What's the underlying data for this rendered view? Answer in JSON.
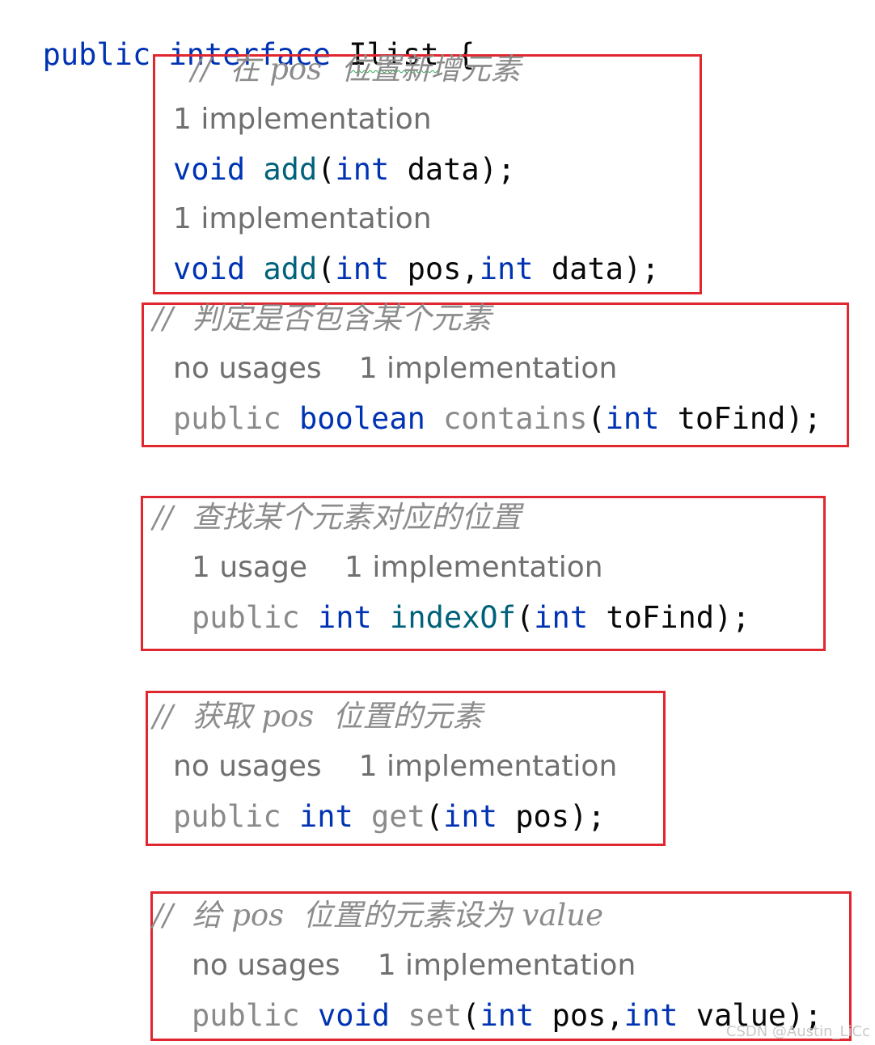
{
  "header": {
    "kw_public": "public",
    "kw_interface": "interface",
    "name": "Ilist",
    "brace": "{"
  },
  "blocks": [
    {
      "comment": "//  在 pos  位置新增元素",
      "items": [
        {
          "hints": [
            "1 implementation"
          ],
          "sig": [
            "void",
            "add",
            "(",
            "int",
            " data);"
          ]
        },
        {
          "hints": [
            "1 implementation"
          ],
          "sig": [
            "void",
            "add",
            "(",
            "int",
            " pos,",
            "int",
            " data);"
          ]
        }
      ]
    },
    {
      "comment": "//  判定是否包含某个元素",
      "hints": [
        "no usages",
        "1 implementation"
      ],
      "sig": [
        "public",
        "boolean",
        "contains",
        "(",
        "int",
        " toFind);"
      ]
    },
    {
      "comment": "//  查找某个元素对应的位置",
      "hints": [
        "1 usage",
        "1 implementation"
      ],
      "sig": [
        "public",
        "int",
        "indexOf",
        "(",
        "int",
        " toFind);"
      ]
    },
    {
      "comment": "//  获取 pos  位置的元素",
      "hints": [
        "no usages",
        "1 implementation"
      ],
      "sig": [
        "public",
        "int",
        "get",
        "(",
        "int",
        " pos);"
      ]
    },
    {
      "comment": "//  给 pos  位置的元素设为 value",
      "hints": [
        "no usages",
        "1 implementation"
      ],
      "sig": [
        "public",
        "void",
        "set",
        "(",
        "int",
        " pos,",
        "int",
        " value);"
      ]
    }
  ],
  "watermark": "CSDN @Austin_LiCc",
  "colors": {
    "keyword": "#0033b3",
    "method": "#00627a",
    "comment": "#8c8c8c",
    "hint": "#6f6f6f",
    "box": "#e0262f"
  }
}
